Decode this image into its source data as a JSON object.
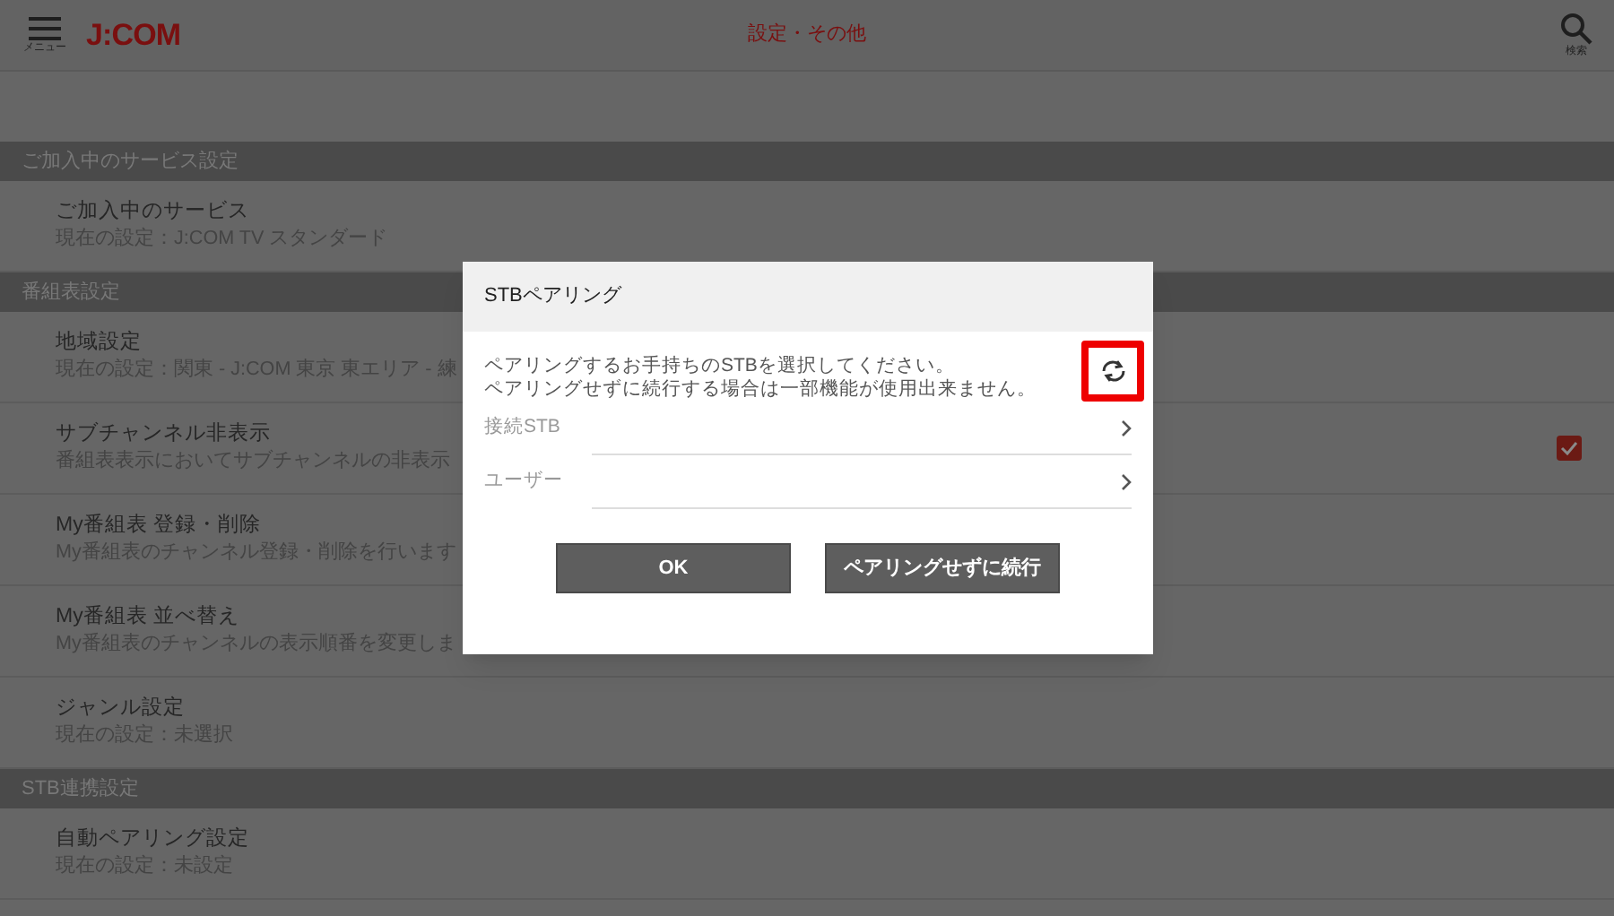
{
  "header": {
    "menu_label": "メニュー",
    "logo": "J:COM",
    "title": "設定・その他",
    "search_label": "検索"
  },
  "sections": [
    {
      "title": "ご加入中のサービス設定",
      "items": [
        {
          "kind": "plain",
          "title": "ご加入中のサービス",
          "subtitle": "現在の設定：J:COM TV スタンダード"
        }
      ]
    },
    {
      "title": "番組表設定",
      "items": [
        {
          "kind": "plain",
          "title": "地域設定",
          "subtitle": "現在の設定：関東 - J:COM 東京 東エリア - 練"
        },
        {
          "kind": "checkbox",
          "title": "サブチャンネル非表示",
          "subtitle": "番組表表示においてサブチャンネルの非表示",
          "checked": true
        },
        {
          "kind": "plain",
          "title": "My番組表 登録・削除",
          "subtitle": "My番組表のチャンネル登録・削除を行います"
        },
        {
          "kind": "plain",
          "title": "My番組表 並べ替え",
          "subtitle": "My番組表のチャンネルの表示順番を変更しま"
        },
        {
          "kind": "plain",
          "title": "ジャンル設定",
          "subtitle": "現在の設定：未選択"
        }
      ]
    },
    {
      "title": "STB連携設定",
      "items": [
        {
          "kind": "plain",
          "title": "自動ペアリング設定",
          "subtitle": "現在の設定：未設定"
        }
      ]
    }
  ],
  "dialog": {
    "title": "STBペアリング",
    "message": [
      "ペアリングするお手持ちのSTBを選択してください。",
      "ペアリングせずに続行する場合は一部機能が使用出来ません。"
    ],
    "fields": [
      {
        "label": "接続STB"
      },
      {
        "label": "ユーザー"
      }
    ],
    "buttons": [
      "OK",
      "ペアリングせずに続行"
    ]
  }
}
